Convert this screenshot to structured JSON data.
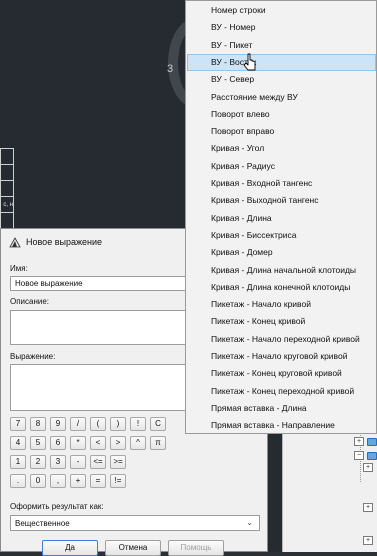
{
  "viewport": {
    "compass_label": "3",
    "table_cells": [
      "",
      "",
      "",
      "c, н",
      "",
      ""
    ]
  },
  "dialog": {
    "title": "Новое выражение",
    "name_label": "Имя:",
    "name_value": "Новое выражение",
    "description_label": "Описание:",
    "description_value": "",
    "expression_label": "Выражение:",
    "expression_value": "",
    "keypad_rows": [
      [
        "7",
        "8",
        "9",
        "/",
        "(",
        ")",
        "!",
        "C"
      ],
      [
        "4",
        "5",
        "6",
        "*",
        "<",
        ">",
        "^",
        "π"
      ],
      [
        "1",
        "2",
        "3",
        "-",
        "<=",
        ">="
      ],
      [
        ".",
        "0",
        ",",
        "+",
        "=",
        "!="
      ]
    ],
    "format_label": "Оформить результат как:",
    "format_value": "Вещественное",
    "ok_label": "Да",
    "cancel_label": "Отмена",
    "help_label": "Помощь"
  },
  "menu": {
    "highlighted_index": 3,
    "items": [
      "Номер строки",
      "ВУ - Номер",
      "ВУ - Пикет",
      "ВУ - Восток",
      "ВУ - Север",
      "Расстояние между ВУ",
      "Поворот влево",
      "Поворот вправо",
      "Кривая - Угол",
      "Кривая - Радиус",
      "Кривая - Входной тангенс",
      "Кривая - Выходной тангенс",
      "Кривая - Длина",
      "Кривая - Биссектриса",
      "Кривая - Домер",
      "Кривая - Длина начальной клотоиды",
      "Кривая - Длина конечной клотоиды",
      "Пикетаж - Начало кривой",
      "Пикетаж - Конец кривой",
      "Пикетаж - Начало переходной кривой",
      "Пикетаж - Начало круговой кривой",
      "Пикетаж - Конец круговой кривой",
      "Пикетаж - Конец переходной кривой",
      "Прямая вставка - Длина",
      "Прямая вставка - Направление"
    ]
  },
  "colors": {
    "viewport_bg": "#262b31",
    "dialog_bg": "#f0f0f0",
    "menu_highlight": "#cce4f7",
    "menu_highlight_border": "#93c4ec"
  }
}
